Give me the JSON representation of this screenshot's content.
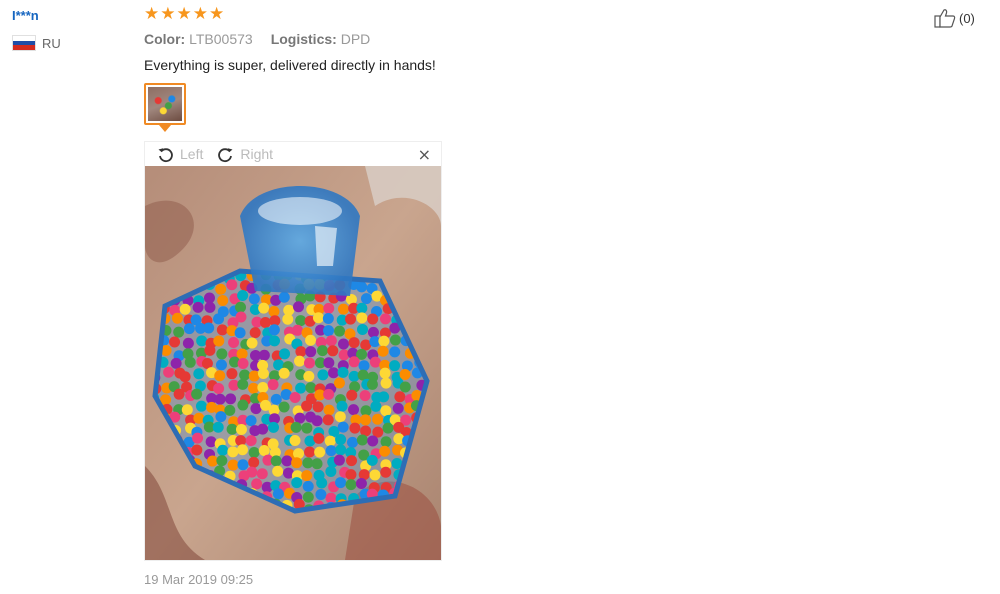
{
  "reviewer": {
    "name": "I***n",
    "country": "RU",
    "flag_colors": [
      "#ffffff",
      "#1f4ea8",
      "#d52b1e"
    ]
  },
  "rating": {
    "stars": 5,
    "max": 5,
    "color": "#f7961d",
    "glyph": "★"
  },
  "meta": {
    "color_label": "Color:",
    "color_value": "LTB00573",
    "logistics_label": "Logistics:",
    "logistics_value": "DPD"
  },
  "review": {
    "text": "Everything is super, delivered directly in hands!",
    "date": "19 Mar 2019 09:25"
  },
  "viewer": {
    "rotate_left_label": "Left",
    "rotate_right_label": "Right",
    "close_glyph": "×"
  },
  "helpful": {
    "count_text": "(0)",
    "icon": "thumbs-up-icon"
  },
  "accent_color": "#f08a24"
}
